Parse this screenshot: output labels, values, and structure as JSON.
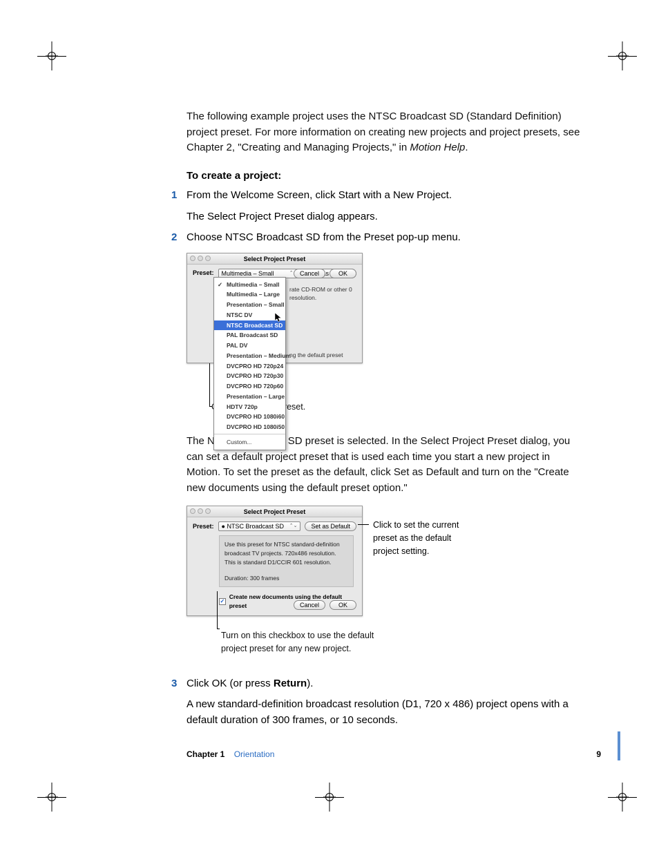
{
  "intro": {
    "p1a": "The following example project uses the NTSC Broadcast SD (Standard Definition) project preset. For more information on creating new projects and project presets, see Chapter 2, \"Creating and Managing Projects,\" in ",
    "p1_em": "Motion Help",
    "p1b": "."
  },
  "heading": "To create a project:",
  "steps": {
    "s1": {
      "num": "1",
      "text": "From the Welcome Screen, click Start with a New Project.",
      "after": "The Select Project Preset dialog appears."
    },
    "s2": {
      "num": "2",
      "text": "Choose NTSC Broadcast SD from the Preset pop-up menu."
    },
    "s3": {
      "num": "3",
      "text_a": "Click OK (or press ",
      "text_bold": "Return",
      "text_b": ").",
      "after": "A new standard-definition broadcast resolution (D1, 720 x 486) project opens with a default duration of 300 frames, or 10 seconds."
    }
  },
  "dialog": {
    "title": "Select Project Preset",
    "presetLabel": "Preset:",
    "setDefault": "Set as Default",
    "cancel": "Cancel",
    "ok": "OK"
  },
  "fig1": {
    "comboValue": "Multimedia – Small",
    "menu": [
      "Multimedia – Small",
      "Multimedia – Large",
      "Presentation – Small",
      "NTSC DV",
      "NTSC Broadcast SD",
      "PAL Broadcast SD",
      "PAL DV",
      "Presentation – Medium",
      "DVCPRO HD 720p24",
      "DVCPRO HD 720p30",
      "DVCPRO HD 720p60",
      "Presentation – Large",
      "HDTV 720p",
      "DVCPRO HD 1080i60",
      "DVCPRO HD 1080i50"
    ],
    "menuCustom": "Custom...",
    "descSnip": "rate CD-ROM or other 0 resolution.",
    "belowSnip": "ng the default preset",
    "caption": "Choose a project preset."
  },
  "midPara": "The NTSC Broadcast SD preset is selected. In the Select Project Preset dialog, you can set a default project preset that is used each time you start a new project in Motion. To set the preset as the default, click Set as Default and turn on the \"Create new documents using the default preset option.\"",
  "fig2": {
    "comboValue": "● NTSC Broadcast SD",
    "desc1": "Use this preset for NTSC standard-definition broadcast TV projects. 720x486 resolution. This is standard D1/CCIR 601 resolution.",
    "desc2": "Duration: 300 frames",
    "checkboxLabel": "Create new documents using the default preset",
    "annotRight": "Click to set the current preset as the default project setting.",
    "caption": "Turn on this checkbox to use the default project preset for any new project."
  },
  "footer": {
    "chapter": "Chapter 1",
    "section": "Orientation",
    "page": "9"
  }
}
